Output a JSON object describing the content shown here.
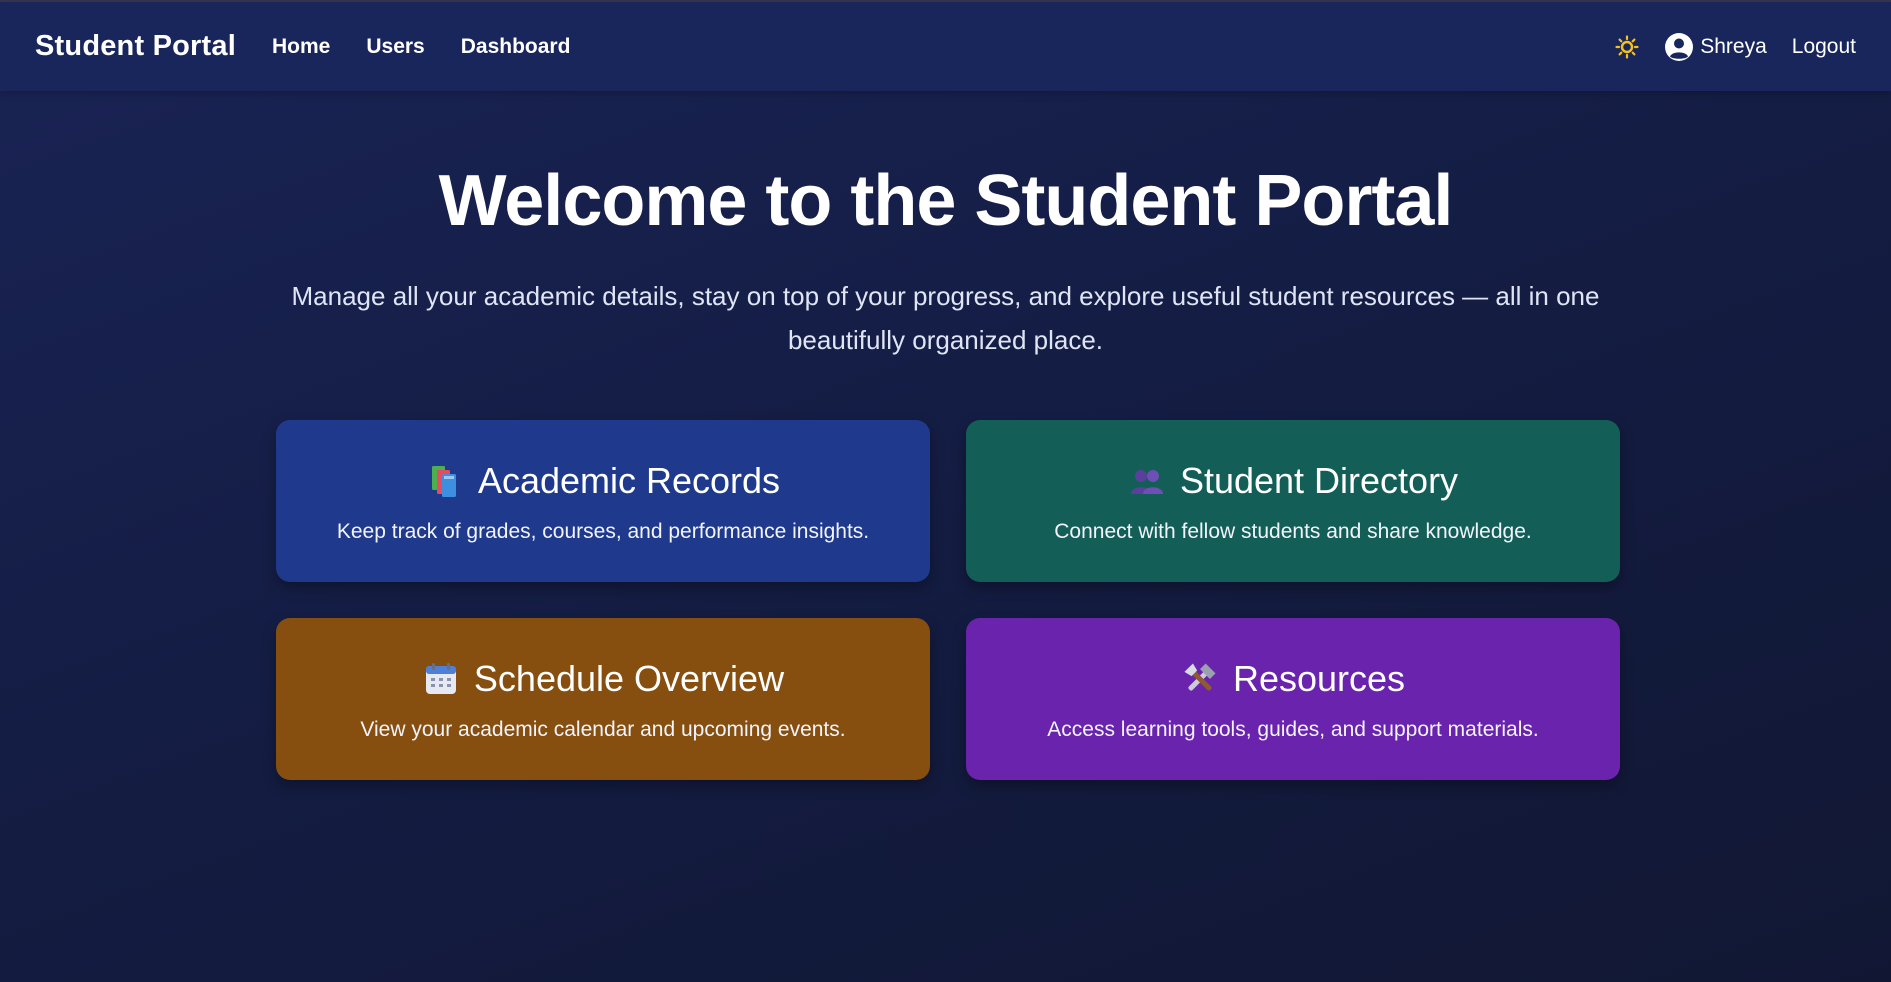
{
  "nav": {
    "brand": "Student Portal",
    "links": [
      "Home",
      "Users",
      "Dashboard"
    ],
    "theme_icon": "sun-icon",
    "user_icon": "user-circle-icon",
    "user_name": "Shreya",
    "logout": "Logout"
  },
  "hero": {
    "title": "Welcome to the Student Portal",
    "subtitle": "Manage all your academic details, stay on top of your progress, and explore useful student resources — all in one beautifully organized place."
  },
  "cards": [
    {
      "icon": "books-icon",
      "title": "Academic Records",
      "description": "Keep track of grades, courses, and performance insights.",
      "color": "#1f3a8c"
    },
    {
      "icon": "people-icon",
      "title": "Student Directory",
      "description": "Connect with fellow students and share knowledge.",
      "color": "#135f58"
    },
    {
      "icon": "calendar-icon",
      "title": "Schedule Overview",
      "description": "View your academic calendar and upcoming events.",
      "color": "#864f10"
    },
    {
      "icon": "tools-icon",
      "title": "Resources",
      "description": "Access learning tools, guides, and support materials.",
      "color": "#6a23ac"
    }
  ],
  "colors": {
    "nav_bg": "#19265c",
    "page_bg": "#141d44",
    "sun": "#f4c21a"
  }
}
